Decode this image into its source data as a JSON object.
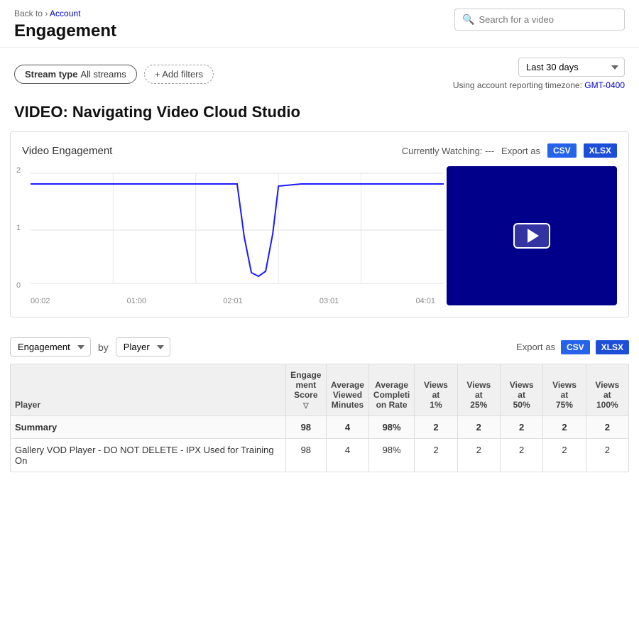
{
  "breadcrumb": {
    "back_text": "Back to",
    "separator": "›",
    "account_text": "Account"
  },
  "page_title": "Engagement",
  "search": {
    "placeholder": "Search for a video"
  },
  "filters": {
    "stream_type_label": "Stream type",
    "stream_type_value": "All streams",
    "add_filters_label": "+ Add filters",
    "date_range": "Last 30 days",
    "timezone_label": "Using account reporting timezone:",
    "timezone_value": "GMT-0400"
  },
  "video_title": "VIDEO: Navigating Video Cloud Studio",
  "chart": {
    "title": "Video Engagement",
    "currently_watching_label": "Currently Watching:",
    "currently_watching_value": "---",
    "export_label": "Export as",
    "export_csv": "CSV",
    "export_xlsx": "XLSX",
    "x_axis": [
      "00:02",
      "01:00",
      "02:01",
      "03:01",
      "04:01"
    ],
    "y_axis": [
      "2",
      "1",
      "0"
    ]
  },
  "table": {
    "export_label": "Export as",
    "export_csv": "CSV",
    "export_xlsx": "XLSX",
    "group_by_label": "by",
    "dropdown1": "Engagement",
    "dropdown2": "Player",
    "columns": [
      "Player",
      "Engagement Score",
      "Average Viewed Minutes",
      "Average Completion Rate",
      "Views at 1%",
      "Views at 25%",
      "Views at 50%",
      "Views at 75%",
      "Views at 100%"
    ],
    "summary": {
      "label": "Summary",
      "engagement_score": "98",
      "avg_viewed_minutes": "4",
      "avg_completion_rate": "98%",
      "views_1": "2",
      "views_25": "2",
      "views_50": "2",
      "views_75": "2",
      "views_100": "2"
    },
    "rows": [
      {
        "player": "Gallery VOD Player - DO NOT DELETE - IPX Used for Training On",
        "engagement_score": "98",
        "avg_viewed_minutes": "4",
        "avg_completion_rate": "98%",
        "views_1": "2",
        "views_25": "2",
        "views_50": "2",
        "views_75": "2",
        "views_100": "2"
      }
    ]
  }
}
